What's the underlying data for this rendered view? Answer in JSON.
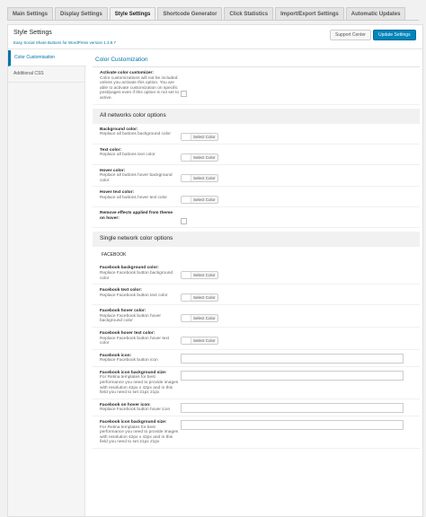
{
  "tabs": [
    "Main Settings",
    "Display Settings",
    "Style Settings",
    "Shortcode Generator",
    "Click Statistics",
    "Import/Export Settings",
    "Automatic Updates"
  ],
  "active_tab_index": 2,
  "header": {
    "title": "Style Settings",
    "subtitle": "Easy Social Share Buttons for WordPress version 1.3.9.7",
    "support_label": "Support Center",
    "update_label": "Update Settings"
  },
  "sidebar": {
    "items": [
      {
        "label": "Color Customisation",
        "active": true
      },
      {
        "label": "Additional CSS",
        "active": false
      }
    ]
  },
  "main": {
    "section_title": "Color Customization",
    "activate": {
      "title": "Activate color customizer:",
      "desc": "Color customizations will not be included unless you activate this option. You are able to activate customization on specific post/pages even if this option is not set to active."
    },
    "all_networks_heading": "All networks color options",
    "all_rows": [
      {
        "title": "Background color:",
        "desc": "Replace all buttons background color",
        "type": "color"
      },
      {
        "title": "Text color:",
        "desc": "Replace all buttons text color",
        "type": "color"
      },
      {
        "title": "Hover color:",
        "desc": "Replace all buttons hover background color",
        "type": "color"
      },
      {
        "title": "Hover text color:",
        "desc": "Replace all buttons hover text color",
        "type": "color"
      },
      {
        "title": "Remove effects applied from theme on hover:",
        "desc": "",
        "type": "checkbox"
      }
    ],
    "single_network_heading": "Single network color options",
    "network_label": "FACEBOOK",
    "fb_rows": [
      {
        "title": "Facebook background color:",
        "desc": "Replace Facebook button background color",
        "type": "color"
      },
      {
        "title": "Facebook text color:",
        "desc": "Replace Facebook button text color",
        "type": "color"
      },
      {
        "title": "Facebook hover color:",
        "desc": "Replace Facebook button hover background color",
        "type": "color"
      },
      {
        "title": "Facebook hover text color:",
        "desc": "Replace Facebook button hover text color",
        "type": "color"
      },
      {
        "title": "Facebook icon:",
        "desc": "Replace Facebook button icon",
        "type": "input"
      },
      {
        "title": "Facebook icon background size:",
        "desc": "For Retina templates for best performance you need to provide images with resolution 42px x 42px and in this field you need to set 21px 21px",
        "type": "input"
      },
      {
        "title": "Facebook on hover icon:",
        "desc": "Replace Facebook button hover icon",
        "type": "input"
      },
      {
        "title": "Facebook icon background size:",
        "desc": "For Retina templates for best performance you need to provide images with resolution 42px x 42px and in this field you need to set 21px 21px",
        "type": "input"
      }
    ],
    "select_color_label": "Select Color"
  },
  "colors": {
    "accent": "#0073aa",
    "button_primary": "#0085ba"
  }
}
